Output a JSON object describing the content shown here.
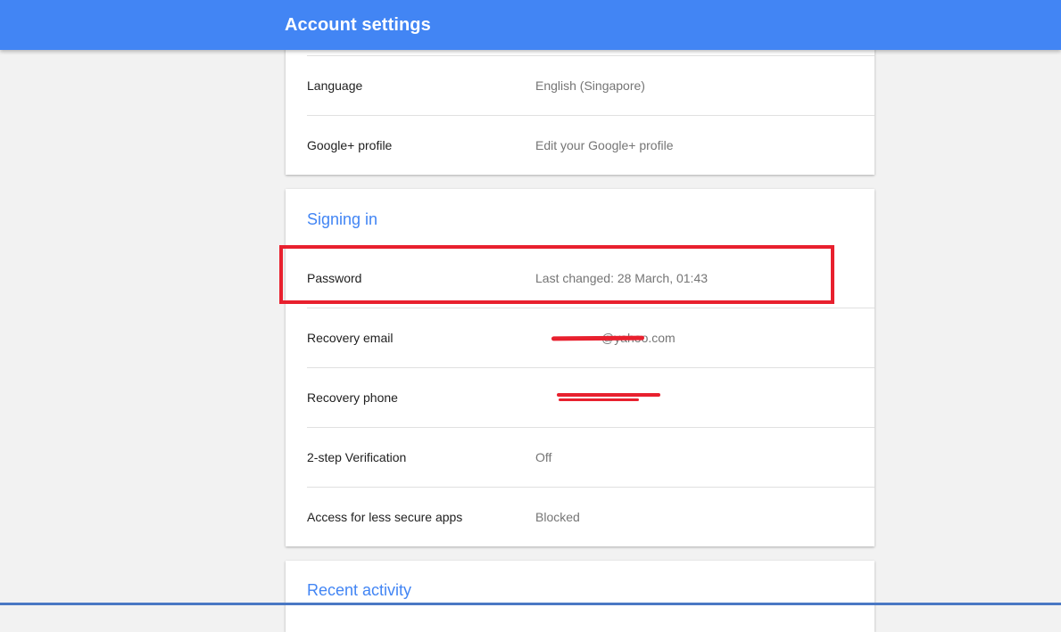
{
  "header": {
    "title": "Account settings"
  },
  "general": {
    "language": {
      "label": "Language",
      "value": "English (Singapore)"
    },
    "google_plus": {
      "label": "Google+ profile",
      "value": "Edit your Google+ profile"
    }
  },
  "signing_in": {
    "title": "Signing in",
    "password": {
      "label": "Password",
      "value": "Last changed: 28 March, 01:43"
    },
    "recovery_email": {
      "label": "Recovery email",
      "value": "@yahoo.com"
    },
    "recovery_phone": {
      "label": "Recovery phone",
      "value": ""
    },
    "two_step": {
      "label": "2-step Verification",
      "value": "Off"
    },
    "less_secure": {
      "label": "Access for less secure apps",
      "value": "Blocked"
    }
  },
  "recent_activity": {
    "title": "Recent activity"
  },
  "colors": {
    "header_bg": "#4285f4",
    "accent": "#4285f4",
    "highlight": "#e8202e",
    "background": "#f2f2f2"
  }
}
